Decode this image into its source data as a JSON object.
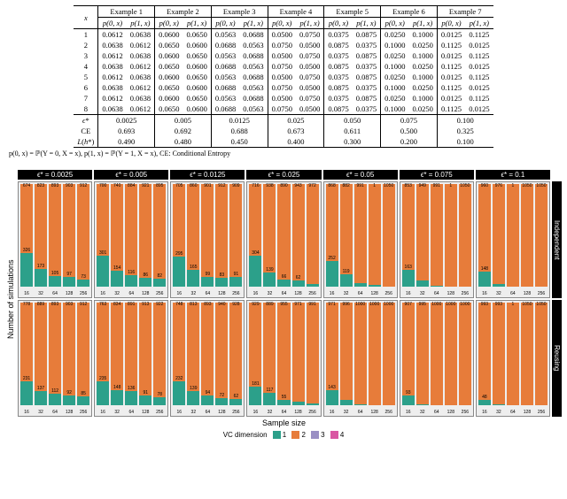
{
  "table": {
    "col_header_x": "x",
    "examples": [
      "Example 1",
      "Example 2",
      "Example 3",
      "Example 4",
      "Example 5",
      "Example 6",
      "Example 7"
    ],
    "sub_p0": "p(0, x)",
    "sub_p1": "p(1, x)",
    "rows": [
      {
        "x": "1",
        "cells": [
          [
            "0.0612",
            "0.0638"
          ],
          [
            "0.0600",
            "0.0650"
          ],
          [
            "0.0563",
            "0.0688"
          ],
          [
            "0.0500",
            "0.0750"
          ],
          [
            "0.0375",
            "0.0875"
          ],
          [
            "0.0250",
            "0.1000"
          ],
          [
            "0.0125",
            "0.1125"
          ]
        ]
      },
      {
        "x": "2",
        "cells": [
          [
            "0.0638",
            "0.0612"
          ],
          [
            "0.0650",
            "0.0600"
          ],
          [
            "0.0688",
            "0.0563"
          ],
          [
            "0.0750",
            "0.0500"
          ],
          [
            "0.0875",
            "0.0375"
          ],
          [
            "0.1000",
            "0.0250"
          ],
          [
            "0.1125",
            "0.0125"
          ]
        ]
      },
      {
        "x": "3",
        "cells": [
          [
            "0.0612",
            "0.0638"
          ],
          [
            "0.0600",
            "0.0650"
          ],
          [
            "0.0563",
            "0.0688"
          ],
          [
            "0.0500",
            "0.0750"
          ],
          [
            "0.0375",
            "0.0875"
          ],
          [
            "0.0250",
            "0.1000"
          ],
          [
            "0.0125",
            "0.1125"
          ]
        ]
      },
      {
        "x": "4",
        "cells": [
          [
            "0.0638",
            "0.0612"
          ],
          [
            "0.0650",
            "0.0600"
          ],
          [
            "0.0688",
            "0.0563"
          ],
          [
            "0.0750",
            "0.0500"
          ],
          [
            "0.0875",
            "0.0375"
          ],
          [
            "0.1000",
            "0.0250"
          ],
          [
            "0.1125",
            "0.0125"
          ]
        ]
      },
      {
        "x": "5",
        "cells": [
          [
            "0.0612",
            "0.0638"
          ],
          [
            "0.0600",
            "0.0650"
          ],
          [
            "0.0563",
            "0.0688"
          ],
          [
            "0.0500",
            "0.0750"
          ],
          [
            "0.0375",
            "0.0875"
          ],
          [
            "0.0250",
            "0.1000"
          ],
          [
            "0.0125",
            "0.1125"
          ]
        ]
      },
      {
        "x": "6",
        "cells": [
          [
            "0.0638",
            "0.0612"
          ],
          [
            "0.0650",
            "0.0600"
          ],
          [
            "0.0688",
            "0.0563"
          ],
          [
            "0.0750",
            "0.0500"
          ],
          [
            "0.0875",
            "0.0375"
          ],
          [
            "0.1000",
            "0.0250"
          ],
          [
            "0.1125",
            "0.0125"
          ]
        ]
      },
      {
        "x": "7",
        "cells": [
          [
            "0.0612",
            "0.0638"
          ],
          [
            "0.0600",
            "0.0650"
          ],
          [
            "0.0563",
            "0.0688"
          ],
          [
            "0.0500",
            "0.0750"
          ],
          [
            "0.0375",
            "0.0875"
          ],
          [
            "0.0250",
            "0.1000"
          ],
          [
            "0.0125",
            "0.1125"
          ]
        ]
      },
      {
        "x": "8",
        "cells": [
          [
            "0.0638",
            "0.0612"
          ],
          [
            "0.0650",
            "0.0600"
          ],
          [
            "0.0688",
            "0.0563"
          ],
          [
            "0.0750",
            "0.0500"
          ],
          [
            "0.0875",
            "0.0375"
          ],
          [
            "0.1000",
            "0.0250"
          ],
          [
            "0.1125",
            "0.0125"
          ]
        ]
      }
    ],
    "footer_rows": [
      {
        "label": "ϵ*",
        "vals": [
          "0.0025",
          "0.005",
          "0.0125",
          "0.025",
          "0.050",
          "0.075",
          "0.100"
        ]
      },
      {
        "label": "CE",
        "vals": [
          "0.693",
          "0.692",
          "0.688",
          "0.673",
          "0.611",
          "0.500",
          "0.325"
        ]
      },
      {
        "label": "L(h*)",
        "vals": [
          "0.490",
          "0.480",
          "0.450",
          "0.400",
          "0.300",
          "0.200",
          "0.100"
        ]
      }
    ],
    "footnote": "p(0, x) = ℙ(Y = 0, X = x), p(1, x) = ℙ(Y = 1, X = x), CE: Conditional Entropy"
  },
  "chart_data": {
    "type": "bar",
    "facet_cols": [
      "ϵ* = 0.0025",
      "ϵ* = 0.005",
      "ϵ* = 0.0125",
      "ϵ* = 0.025",
      "ϵ* = 0.05",
      "ϵ* = 0.075",
      "ϵ* = 0.1"
    ],
    "facet_rows": [
      "Independent",
      "Reusing"
    ],
    "x_categories": [
      "16",
      "32",
      "64",
      "128",
      "256"
    ],
    "xlabel": "Sample size",
    "ylabel": "Number of simulations",
    "ylim": [
      0,
      1000
    ],
    "legend_title": "VC dimension",
    "legend_items": [
      "1",
      "2",
      "3",
      "4"
    ],
    "colors": {
      "1": "#2ca08a",
      "2": "#e77c3a",
      "3": "#9a8fc4",
      "4": "#d957a3"
    },
    "series": {
      "Independent": [
        [
          {
            "1": 326,
            "2": 674
          },
          {
            "1": 173,
            "2": 827,
            "labels": [
              "173",
              "823"
            ]
          },
          {
            "1": 105,
            "2": 895,
            "labels": [
              "105",
              "893"
            ]
          },
          {
            "1": 97,
            "2": 903,
            "labels": [
              "97",
              "903"
            ]
          },
          {
            "1": 73,
            "2": 927,
            "labels": [
              "73",
              "912"
            ]
          }
        ],
        [
          {
            "1": 301,
            "2": 699,
            "labels": [
              "301",
              "700"
            ]
          },
          {
            "1": 154,
            "2": 846,
            "labels": [
              "154",
              "740"
            ]
          },
          {
            "1": 116,
            "2": 884,
            "labels": [
              "116",
              "884"
            ]
          },
          {
            "1": 86,
            "2": 914,
            "labels": [
              "86",
              "921"
            ]
          },
          {
            "1": 82,
            "2": 918,
            "labels": [
              "82",
              "895"
            ]
          }
        ],
        [
          {
            "1": 295,
            "2": 705,
            "labels": [
              "295",
              "705"
            ]
          },
          {
            "1": 165,
            "2": 835,
            "labels": [
              "165",
              "860"
            ]
          },
          {
            "1": 99,
            "2": 901,
            "labels": [
              "99",
              "901"
            ]
          },
          {
            "1": 83,
            "2": 917,
            "labels": [
              "83",
              "912"
            ]
          },
          {
            "1": 91,
            "2": 909,
            "labels": [
              "91",
              "909"
            ]
          }
        ],
        [
          {
            "1": 304,
            "2": 696,
            "labels": [
              "304",
              "716"
            ]
          },
          {
            "1": 139,
            "2": 861,
            "labels": [
              "139",
              "938"
            ]
          },
          {
            "1": 66,
            "2": 934,
            "labels": [
              "66",
              "890"
            ]
          },
          {
            "1": 62,
            "2": 938,
            "labels": [
              "62",
              "943"
            ]
          },
          {
            "1": 28,
            "2": 972,
            "labels": [
              "28",
              "972"
            ]
          }
        ],
        [
          {
            "1": 252,
            "2": 748,
            "labels": [
              "252",
              "868"
            ]
          },
          {
            "1": 119,
            "2": 881,
            "labels": [
              "119",
              "882"
            ]
          },
          {
            "1": 31,
            "2": 969,
            "labels": [
              "",
              "991"
            ]
          },
          {
            "1": 20,
            "2": 980,
            "labels": [
              "",
              "1"
            ]
          },
          {
            "1": 0,
            "2": 1000,
            "labels": [
              "",
              "1050"
            ]
          }
        ],
        [
          {
            "1": 163,
            "2": 837,
            "labels": [
              "163",
              "853"
            ]
          },
          {
            "1": 58,
            "2": 942,
            "labels": [
              "",
              "949"
            ]
          },
          {
            "1": 9,
            "2": 991,
            "labels": [
              "",
              "991"
            ]
          },
          {
            "1": 0,
            "2": 1000,
            "labels": [
              "",
              "1"
            ]
          },
          {
            "1": 0,
            "2": 1000,
            "labels": [
              "",
              "1050"
            ]
          }
        ],
        [
          {
            "1": 148,
            "2": 852,
            "labels": [
              "148",
              "960"
            ]
          },
          {
            "1": 24,
            "2": 976,
            "labels": [
              "",
              "976"
            ]
          },
          {
            "1": 0,
            "2": 1000,
            "labels": [
              "",
              "1"
            ]
          },
          {
            "1": 0,
            "2": 1000,
            "labels": [
              "",
              "1050"
            ]
          },
          {
            "1": 0,
            "2": 1000,
            "labels": [
              "",
              "1050"
            ]
          }
        ]
      ],
      "Reusing": [
        [
          {
            "1": 231,
            "2": 769,
            "labels": [
              "231",
              "778"
            ]
          },
          {
            "1": 137,
            "2": 863,
            "labels": [
              "137",
              "889"
            ]
          },
          {
            "1": 112,
            "2": 888,
            "labels": [
              "112",
              "893"
            ]
          },
          {
            "1": 92,
            "2": 908,
            "labels": [
              "92",
              "903"
            ]
          },
          {
            "1": 85,
            "2": 915,
            "labels": [
              "85",
              "912"
            ]
          }
        ],
        [
          {
            "1": 235,
            "2": 765,
            "labels": [
              "235",
              "763"
            ]
          },
          {
            "1": 148,
            "2": 852,
            "labels": [
              "148",
              "834"
            ]
          },
          {
            "1": 136,
            "2": 864,
            "labels": [
              "136",
              "891"
            ]
          },
          {
            "1": 91,
            "2": 909,
            "labels": [
              "91",
              "913"
            ]
          },
          {
            "1": 78,
            "2": 922,
            "labels": [
              "78",
              "922"
            ]
          }
        ],
        [
          {
            "1": 232,
            "2": 768,
            "labels": [
              "232",
              "748"
            ]
          },
          {
            "1": 139,
            "2": 861,
            "labels": [
              "139",
              "813"
            ]
          },
          {
            "1": 94,
            "2": 906,
            "labels": [
              "94",
              "893"
            ]
          },
          {
            "1": 72,
            "2": 928,
            "labels": [
              "72",
              "940"
            ]
          },
          {
            "1": 62,
            "2": 938,
            "labels": [
              "62",
              "928"
            ]
          }
        ],
        [
          {
            "1": 181,
            "2": 819,
            "labels": [
              "181",
              "929"
            ]
          },
          {
            "1": 117,
            "2": 883,
            "labels": [
              "117",
              "889"
            ]
          },
          {
            "1": 55,
            "2": 945,
            "labels": [
              "55",
              "955"
            ]
          },
          {
            "1": 37,
            "2": 963,
            "labels": [
              "",
              "971"
            ]
          },
          {
            "1": 20,
            "2": 980,
            "labels": [
              "",
              "991"
            ]
          }
        ],
        [
          {
            "1": 143,
            "2": 857,
            "labels": [
              "143",
              "971"
            ]
          },
          {
            "1": 48,
            "2": 952,
            "labels": [
              "",
              "996"
            ]
          },
          {
            "1": 5,
            "2": 995,
            "labels": [
              "",
              "1000"
            ]
          },
          {
            "1": 0,
            "2": 1000,
            "labels": [
              "",
              "1000"
            ]
          },
          {
            "1": 0,
            "2": 1000,
            "labels": [
              "",
              "1000"
            ]
          }
        ],
        [
          {
            "1": 93,
            "2": 907,
            "labels": [
              "93",
              "907"
            ]
          },
          {
            "1": 11,
            "2": 989,
            "labels": [
              "",
              "995"
            ]
          },
          {
            "1": 0,
            "2": 1000,
            "labels": [
              "",
              "1000"
            ]
          },
          {
            "1": 0,
            "2": 1000,
            "labels": [
              "",
              "1000"
            ]
          },
          {
            "1": 0,
            "2": 1000,
            "labels": [
              "",
              "1000"
            ]
          }
        ],
        [
          {
            "1": 48,
            "2": 952,
            "labels": [
              "48",
              "993"
            ]
          },
          {
            "1": 7,
            "2": 993,
            "labels": [
              "",
              "993"
            ]
          },
          {
            "1": 0,
            "2": 1000,
            "labels": [
              "",
              "1"
            ]
          },
          {
            "1": 0,
            "2": 1000,
            "labels": [
              "",
              "1050"
            ]
          },
          {
            "1": 0,
            "2": 1000,
            "labels": [
              "",
              "1050"
            ]
          }
        ]
      ]
    }
  }
}
